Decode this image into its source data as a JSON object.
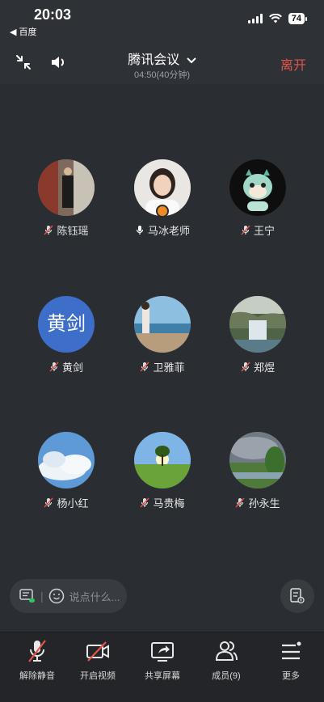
{
  "status_bar": {
    "time": "20:03",
    "back_app": "◀ 百度",
    "battery": "74"
  },
  "topbar": {
    "title": "腾讯会议",
    "duration": "04:50(40分钟)",
    "leave_label": "离开"
  },
  "participants": [
    {
      "name": "陈钰瑶",
      "mic": "muted",
      "avatar": "photo"
    },
    {
      "name": "马冰老师",
      "mic": "on",
      "avatar": "photo",
      "host": true
    },
    {
      "name": "王宁",
      "mic": "muted",
      "avatar": "photo"
    },
    {
      "name": "黄剑",
      "mic": "muted",
      "avatar_text": "黄剑"
    },
    {
      "name": "卫雅菲",
      "mic": "muted",
      "avatar": "photo"
    },
    {
      "name": "郑煜",
      "mic": "muted",
      "avatar": "photo"
    },
    {
      "name": "杨小红",
      "mic": "muted",
      "avatar": "photo"
    },
    {
      "name": "马贵梅",
      "mic": "muted",
      "avatar": "photo"
    },
    {
      "name": "孙永生",
      "mic": "muted",
      "avatar": "photo"
    }
  ],
  "chat": {
    "placeholder": "说点什么..."
  },
  "toolbar": {
    "unmute_label": "解除静音",
    "video_label": "开启视频",
    "share_label": "共享屏幕",
    "members_label": "成员(9)",
    "more_label": "更多"
  },
  "colors": {
    "background": "#2a2d31",
    "leave": "#e5544b",
    "host_badge": "#f08a24",
    "avatar_text_bg": "#3d6ec9"
  }
}
